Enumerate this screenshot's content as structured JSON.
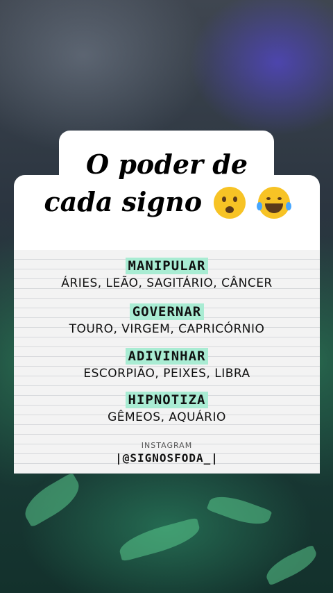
{
  "title_line1": "O poder de",
  "title_line2": "cada signo",
  "emojis": [
    "astonished-face-emoji",
    "tears-of-joy-emoji"
  ],
  "sections": [
    {
      "heading": "MANIPULAR",
      "signs": "ÁRIES, LEÃO, SAGITÁRIO, CÂNCER"
    },
    {
      "heading": "GOVERNAR",
      "signs": "TOURO, VIRGEM, CAPRICÓRNIO"
    },
    {
      "heading": "ADIVINHAR",
      "signs": "ESCORPIÃO, PEIXES, LIBRA"
    },
    {
      "heading": "HIPNOTIZA",
      "signs": "GÊMEOS, AQUÁRIO"
    }
  ],
  "instagram_label": "INSTAGRAM",
  "instagram_handle": "|@SIGNOSFODA_|",
  "colors": {
    "highlight": "#a9ecd3",
    "card": "#f3f3f3",
    "title_bg": "#ffffff"
  }
}
